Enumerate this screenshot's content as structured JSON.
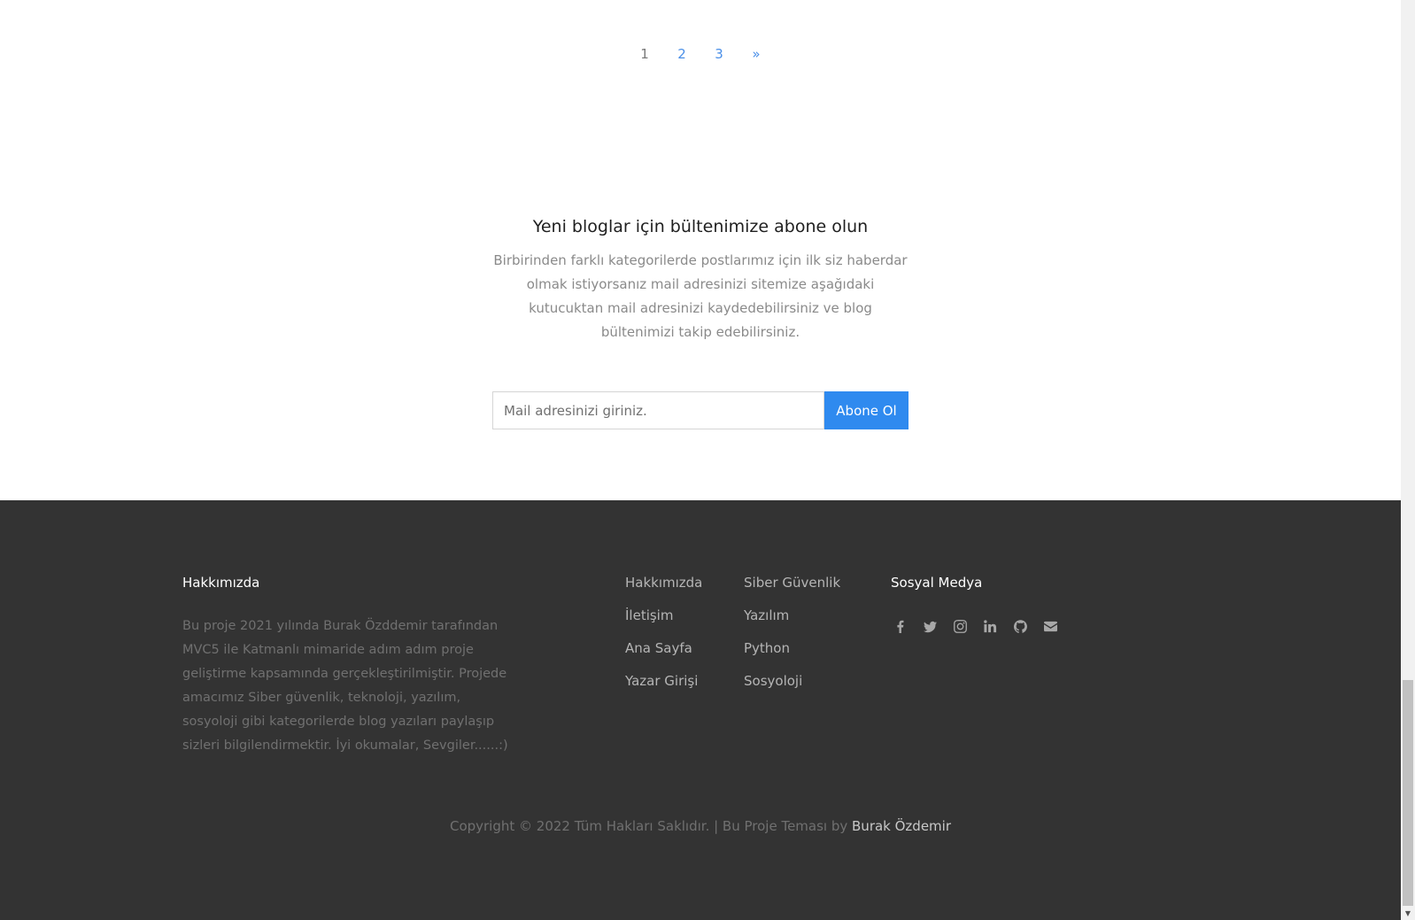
{
  "pagination": {
    "pages": [
      "1",
      "2",
      "3"
    ],
    "next": "»",
    "current": "1"
  },
  "newsletter": {
    "title": "Yeni bloglar için bültenimize abone olun",
    "description": "Birbirinden farklı kategorilerde postlarımız için ilk siz haberdar olmak istiyorsanız mail adresinizi sitemize aşağıdaki kutucuktan mail adresinizi kaydedebilirsiniz ve blog bültenimizi takip edebilirsiniz.",
    "input_placeholder": "Mail adresinizi giriniz.",
    "button_label": "Abone Ol",
    "button_color": "#2f8aef"
  },
  "footer": {
    "background": "#333333",
    "about": {
      "heading": "Hakkımızda",
      "text": "Bu proje 2021 yılında Burak Özddemir tarafından MVC5 ile Katmanlı mimaride adım adım proje geliştirme kapsamında gerçekleştirilmiştir. Projede amacımız Siber güvenlik, teknoloji, yazılım, sosyoloji gibi kategorilerde blog yazıları paylaşıp sizleri bilgilendirmektir. İyi okumalar, Sevgiler......:)"
    },
    "links_col1": [
      "Hakkımızda",
      "İletişim",
      "Ana Sayfa",
      "Yazar Girişi"
    ],
    "links_col2": [
      "Siber Güvenlik",
      "Yazılım",
      "Python",
      "Sosyoloji"
    ],
    "social": {
      "heading": "Sosyal Medya",
      "icons": [
        "facebook-icon",
        "twitter-icon",
        "instagram-icon",
        "linkedin-icon",
        "github-icon",
        "envelope-icon"
      ]
    },
    "copyright_text": "Copyright © 2022 Tüm Hakları Saklıdır. | Bu Proje Teması by ",
    "copyright_author": "Burak Özdemir"
  }
}
